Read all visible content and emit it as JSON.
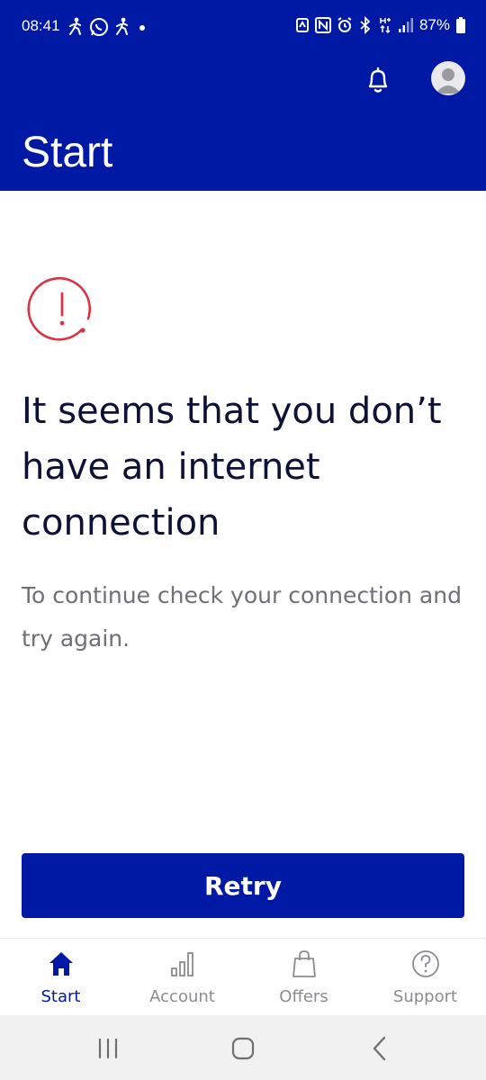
{
  "status_bar": {
    "time": "08:41",
    "battery": "87%",
    "left_icons": [
      "walking-person-icon",
      "whatsapp-icon",
      "walking-person-icon",
      "dot-icon"
    ],
    "right_icons": [
      "alarm-app-icon",
      "nfc-icon",
      "alarm-icon",
      "bluetooth-icon",
      "hplus-data-icon",
      "signal-icon",
      "battery-icon"
    ]
  },
  "header": {
    "title": "Start",
    "icons": [
      "bell-icon",
      "avatar-icon"
    ]
  },
  "error": {
    "icon": "alert-circle-icon",
    "heading": "It seems that you don’t have an internet connection",
    "message": "To continue check your connection and try again."
  },
  "retry": {
    "label": "Retry"
  },
  "bottom_nav": {
    "items": [
      {
        "label": "Start",
        "icon": "home-icon",
        "active": true
      },
      {
        "label": "Account",
        "icon": "bar-chart-icon",
        "active": false
      },
      {
        "label": "Offers",
        "icon": "shopping-bag-icon",
        "active": false
      },
      {
        "label": "Support",
        "icon": "help-circle-icon",
        "active": false
      }
    ]
  },
  "colors": {
    "brand": "#0019a5",
    "alert": "#d93344",
    "heading_text": "#0d1136",
    "secondary_text": "#6f6f74",
    "inactive_nav": "#8b8b90"
  }
}
